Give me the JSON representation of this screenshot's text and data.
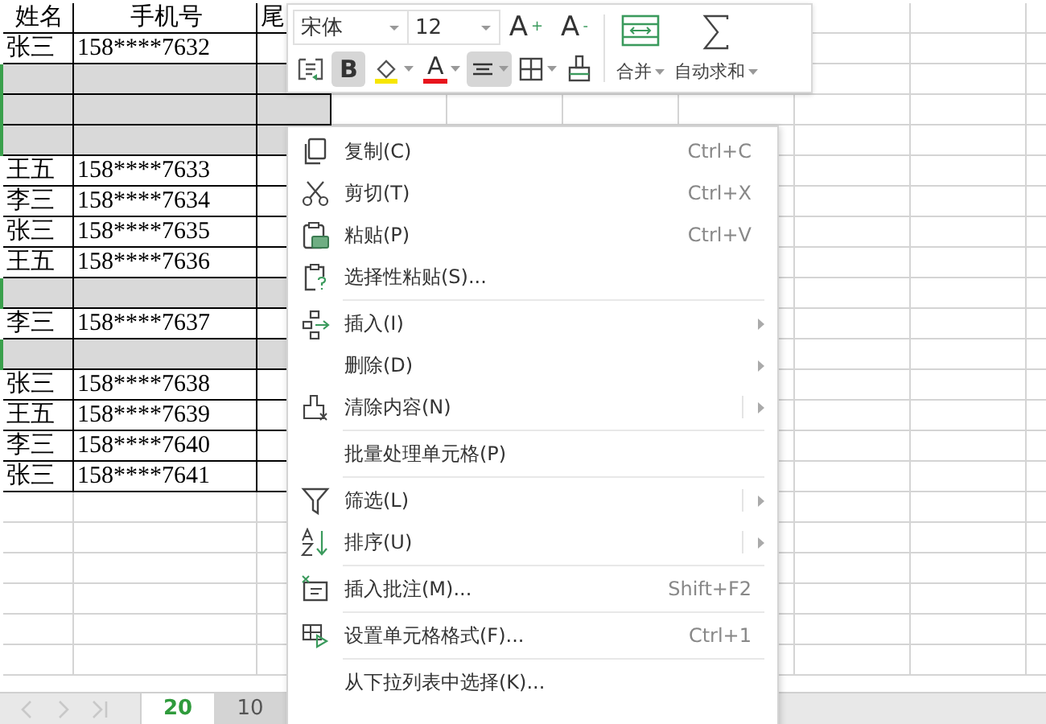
{
  "sheet": {
    "header": [
      "姓名",
      "手机号",
      "尾"
    ],
    "rows": [
      {
        "kind": "data",
        "selected": false,
        "cells": [
          "张三",
          "158****7632"
        ]
      },
      {
        "kind": "shaded",
        "selected": true
      },
      {
        "kind": "shaded",
        "selected": true
      },
      {
        "kind": "shaded",
        "selected": true
      },
      {
        "kind": "data",
        "selected": false,
        "cells": [
          "王五",
          "158****7633"
        ]
      },
      {
        "kind": "data",
        "selected": false,
        "cells": [
          "李三",
          "158****7634"
        ]
      },
      {
        "kind": "data",
        "selected": false,
        "cells": [
          "张三",
          "158****7635"
        ]
      },
      {
        "kind": "data",
        "selected": false,
        "cells": [
          "王五",
          "158****7636"
        ]
      },
      {
        "kind": "shaded",
        "selected": true
      },
      {
        "kind": "data",
        "selected": false,
        "cells": [
          "李三",
          "158****7637"
        ]
      },
      {
        "kind": "shaded",
        "selected": true
      },
      {
        "kind": "data",
        "selected": false,
        "cells": [
          "张三",
          "158****7638"
        ]
      },
      {
        "kind": "data",
        "selected": false,
        "cells": [
          "王五",
          "158****7639"
        ]
      },
      {
        "kind": "data",
        "selected": false,
        "cells": [
          "李三",
          "158****7640"
        ]
      },
      {
        "kind": "data",
        "selected": false,
        "cells": [
          "张三",
          "158****7641"
        ]
      }
    ]
  },
  "sheet_tabs": [
    {
      "label": "20",
      "selected": true
    },
    {
      "label": "10",
      "selected": false
    }
  ],
  "toolbar": {
    "font": "宋体",
    "size": "12",
    "top_buttons": [
      {
        "label": "A$^{+}$"
      },
      {
        "label": "A$^{-}$"
      }
    ],
    "buttons": [
      {
        "kind": "wrap",
        "selected": false
      },
      {
        "kind": "bold",
        "label": "B",
        "selected": true
      },
      {
        "kind": "fill",
        "selected": false
      },
      {
        "kind": "fontcolor",
        "label": "A",
        "selected": false
      },
      {
        "kind": "align",
        "selected": true
      },
      {
        "kind": "borders",
        "selected": false
      },
      {
        "kind": "painter",
        "selected": false
      }
    ],
    "big_buttons": [
      {
        "kind": "merge",
        "label": "合并"
      },
      {
        "kind": "sum",
        "label": "自动求和"
      }
    ]
  },
  "context_menu": {
    "sections": [
      [
        {
          "kind": "copy",
          "label": "复制(C)",
          "shortcut": "Ctrl+C",
          "submenu": false
        },
        {
          "kind": "cut",
          "label": "剪切(T)",
          "shortcut": "Ctrl+X",
          "submenu": false
        },
        {
          "kind": "paste",
          "label": "粘贴(P)",
          "shortcut": "Ctrl+V",
          "submenu": false
        },
        {
          "kind": "paste-special",
          "label": "选择性粘贴(S)...",
          "submenu": false
        }
      ],
      [
        {
          "kind": "insert",
          "label": "插入(I)",
          "submenu": true
        },
        {
          "kind": "plain",
          "label": "删除(D)",
          "submenu": true
        },
        {
          "kind": "clear",
          "label": "清除内容(N)",
          "submenu": true
        }
      ],
      [
        {
          "kind": "plain",
          "label": "批量处理单元格(P)",
          "submenu": false
        }
      ],
      [
        {
          "kind": "filter",
          "label": "筛选(L)",
          "submenu": true
        },
        {
          "kind": "sort",
          "label": "排序(U)",
          "submenu": true
        }
      ],
      [
        {
          "kind": "comment",
          "label": "插入批注(M)...",
          "shortcut": "Shift+F2",
          "submenu": false
        }
      ],
      [
        {
          "kind": "format",
          "label": "设置单元格格式(F)...",
          "shortcut": "Ctrl+1",
          "submenu": false
        }
      ],
      [
        {
          "kind": "plain",
          "label": "从下拉列表中选择(K)...",
          "submenu": false
        }
      ]
    ]
  }
}
